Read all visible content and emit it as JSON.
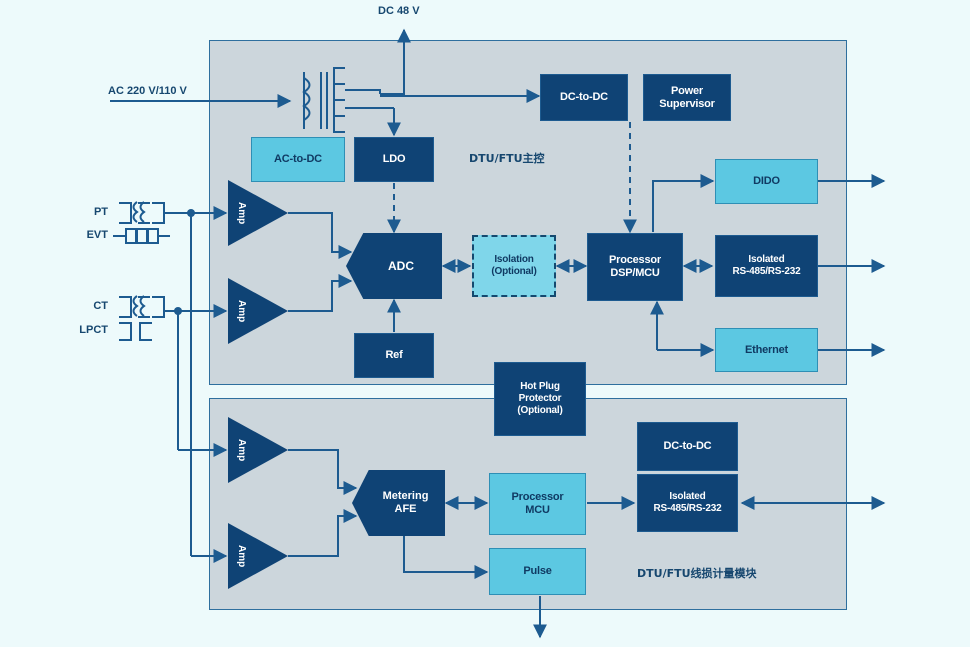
{
  "diagram": {
    "title": "DTU/FTU block diagram",
    "background_color": "#edfafb",
    "panel_color": "#ccd6dc",
    "dark_block_color": "#0f4375",
    "light_block_color": "#5cc8e2",
    "line_color": "#1d5b90",
    "text_color": "#16476f"
  },
  "external_labels": {
    "dc_48v": "DC 48 V",
    "ac_mains": "AC 220 V/110 V",
    "pt": "PT",
    "evt": "EVT",
    "ct": "CT",
    "lpct": "LPCT"
  },
  "panels": [
    {
      "id": "main-control",
      "caption": "DTU/FTU主控"
    },
    {
      "id": "line-loss-metering",
      "caption": "DTU/FTU线损计量模块"
    }
  ],
  "top_panel_blocks": [
    {
      "id": "ac-to-dc",
      "label": "AC-to-DC",
      "style": "light"
    },
    {
      "id": "ldo",
      "label": "LDO",
      "style": "dark"
    },
    {
      "id": "dc-to-dc-top",
      "label": "DC-to-DC",
      "style": "dark"
    },
    {
      "id": "power-supervisor",
      "label": "Power\nSupervisor",
      "style": "dark"
    },
    {
      "id": "adc",
      "label": "ADC",
      "style": "pentagon-dark"
    },
    {
      "id": "isolation",
      "label": "Isolation\n(Optional)",
      "style": "dashed"
    },
    {
      "id": "processor-dsp",
      "label": "Processor\nDSP/MCU",
      "style": "dark"
    },
    {
      "id": "ref",
      "label": "Ref",
      "style": "dark"
    },
    {
      "id": "dido",
      "label": "DIDO",
      "style": "light"
    },
    {
      "id": "isolated-rs-top",
      "label": "Isolated\nRS-485/RS-232",
      "style": "dark"
    },
    {
      "id": "ethernet",
      "label": "Ethernet",
      "style": "light"
    },
    {
      "id": "amp-pt",
      "label": "Amp",
      "style": "triangle-dark"
    },
    {
      "id": "amp-ct",
      "label": "Amp",
      "style": "triangle-dark"
    }
  ],
  "straddle_blocks": [
    {
      "id": "hot-plug-protector",
      "label": "Hot Plug\nProtector\n(Optional)",
      "style": "dark"
    }
  ],
  "bottom_panel_blocks": [
    {
      "id": "amp-lower-1",
      "label": "Amp",
      "style": "triangle-dark"
    },
    {
      "id": "amp-lower-2",
      "label": "Amp",
      "style": "triangle-dark"
    },
    {
      "id": "metering-afe",
      "label": "Metering\nAFE",
      "style": "pentagon-dark"
    },
    {
      "id": "processor-mcu",
      "label": "Processor\nMCU",
      "style": "light"
    },
    {
      "id": "pulse",
      "label": "Pulse",
      "style": "light"
    },
    {
      "id": "dc-to-dc-bottom",
      "label": "DC-to-DC",
      "style": "dark"
    },
    {
      "id": "isolated-rs-bottom",
      "label": "Isolated\nRS-485/RS-232",
      "style": "dark"
    }
  ],
  "block_text": {
    "ac_to_dc": "AC-to-DC",
    "ldo": "LDO",
    "dc_to_dc_top": "DC-to-DC",
    "power_supervisor_line1": "Power",
    "power_supervisor_line2": "Supervisor",
    "adc": "ADC",
    "isolation_line1": "Isolation",
    "isolation_line2": "(Optional)",
    "processor_dsp_line1": "Processor",
    "processor_dsp_line2": "DSP/MCU",
    "ref": "Ref",
    "dido": "DIDO",
    "isolated_rs_top_line1": "Isolated",
    "isolated_rs_top_line2": "RS-485/RS-232",
    "ethernet": "Ethernet",
    "hot_plug_line1": "Hot Plug",
    "hot_plug_line2": "Protector",
    "hot_plug_line3": "(Optional)",
    "metering_afe_line1": "Metering",
    "metering_afe_line2": "AFE",
    "processor_mcu_line1": "Processor",
    "processor_mcu_line2": "MCU",
    "pulse": "Pulse",
    "dc_to_dc_bottom": "DC-to-DC",
    "isolated_rs_bottom_line1": "Isolated",
    "isolated_rs_bottom_line2": "RS-485/RS-232",
    "amp": "Amp",
    "panel_caption_top": "DTU/FTU主控",
    "panel_caption_bottom": "DTU/FTU线损计量模块"
  },
  "symbols": [
    {
      "id": "mains-transformer",
      "name": "transformer-symbol"
    },
    {
      "id": "pt-transformer",
      "name": "transformer-symbol"
    },
    {
      "id": "evt-divider",
      "name": "evt-symbol"
    },
    {
      "id": "ct-transformer",
      "name": "transformer-symbol"
    },
    {
      "id": "lpct-coils",
      "name": "lpct-symbol"
    }
  ]
}
